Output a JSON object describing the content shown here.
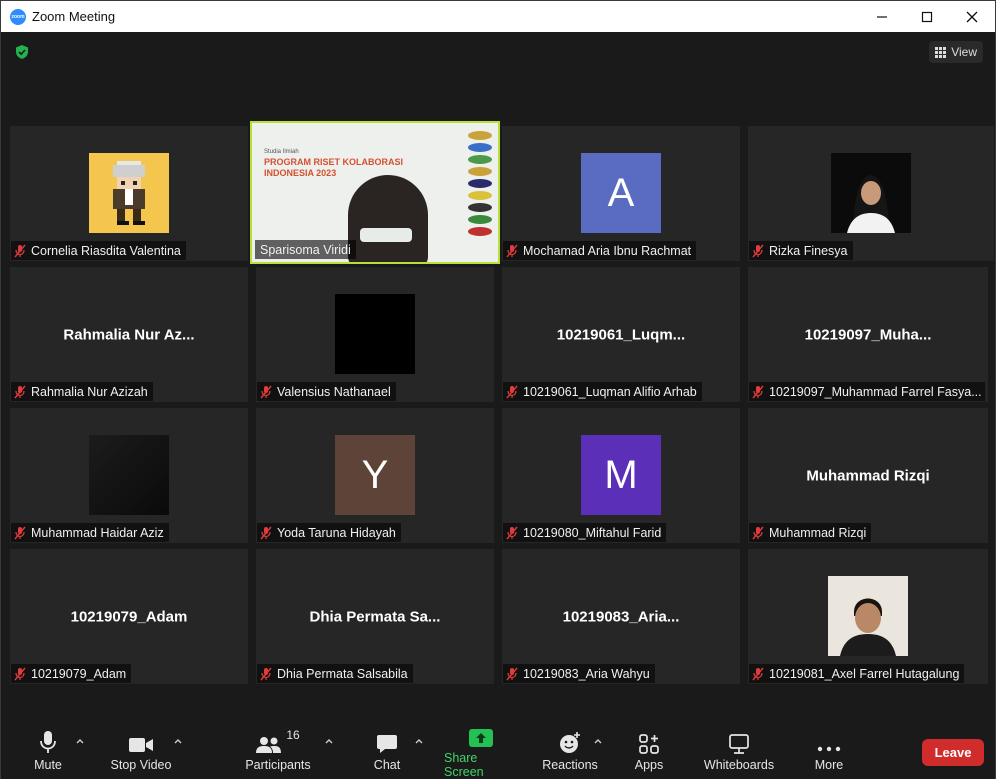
{
  "window": {
    "title": "Zoom Meeting",
    "app_logo_text": "zoom"
  },
  "header": {
    "view_label": "View"
  },
  "tiles": [
    {
      "name": "Cornelia Riasdita Valentina",
      "display": "",
      "type": "pixel-avatar"
    },
    {
      "name": "Sparisoma Viridi",
      "display": "",
      "type": "video",
      "active": true,
      "slide": {
        "line1": "Studia Ilmiah",
        "line2": "PROGRAM RISET KOLABORASI",
        "line3": "INDONESIA 2023"
      }
    },
    {
      "name": "Mochamad Aria Ibnu Rachmat",
      "display": "",
      "type": "letter",
      "letter": "A",
      "color": "#5a6bc2"
    },
    {
      "name": "Rizka Finesya",
      "display": "",
      "type": "photo-hijab"
    },
    {
      "name": "Rahmalia Nur Azizah",
      "display": "Rahmalia Nur Az...",
      "type": "text"
    },
    {
      "name": "Valensius Nathanael",
      "display": "",
      "type": "black"
    },
    {
      "name": "10219061_Luqman Alifio Arhab",
      "display": "10219061_Luqm...",
      "type": "text"
    },
    {
      "name": "10219097_Muhammad Farrel Fasya...",
      "display": "10219097_Muha...",
      "type": "text"
    },
    {
      "name": "Muhammad Haidar Aziz",
      "display": "",
      "type": "dark-photo"
    },
    {
      "name": "Yoda Taruna Hidayah",
      "display": "",
      "type": "letter",
      "letter": "Y",
      "color": "#5e4438"
    },
    {
      "name": "10219080_Miftahul Farid",
      "display": "",
      "type": "letter",
      "letter": "M",
      "color": "#5b2fb8"
    },
    {
      "name": "Muhammad Rizqi",
      "display": "Muhammad Rizqi",
      "type": "text"
    },
    {
      "name": "10219079_Adam",
      "display": "10219079_Adam",
      "type": "text"
    },
    {
      "name": "Dhia Permata Salsabila",
      "display": "Dhia Permata Sa...",
      "type": "text"
    },
    {
      "name": "10219083_Aria Wahyu",
      "display": "10219083_Aria...",
      "type": "text"
    },
    {
      "name": "10219081_Axel Farrel Hutagalung",
      "display": "",
      "type": "photo-man"
    }
  ],
  "toolbar": {
    "mute": "Mute",
    "stop_video": "Stop Video",
    "participants": "Participants",
    "participants_count": "16",
    "chat": "Chat",
    "share_screen": "Share Screen",
    "reactions": "Reactions",
    "apps": "Apps",
    "whiteboards": "Whiteboards",
    "more": "More",
    "leave": "Leave"
  },
  "colors": {
    "accent_green": "#41d46b",
    "leave_red": "#d12c2c",
    "active_speaker": "#b7e03a"
  }
}
